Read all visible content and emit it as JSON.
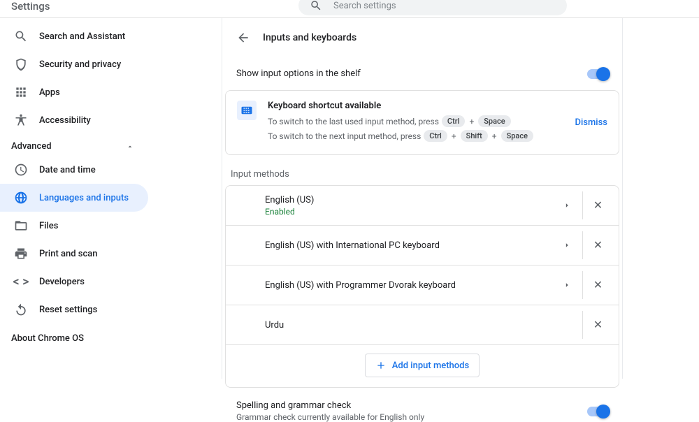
{
  "header": {
    "title": "Settings",
    "search_placeholder": "Search settings"
  },
  "sidebar": {
    "items": [
      {
        "label": "Search and Assistant"
      },
      {
        "label": "Security and privacy"
      },
      {
        "label": "Apps"
      },
      {
        "label": "Accessibility"
      }
    ],
    "advanced_label": "Advanced",
    "advanced_items": [
      {
        "label": "Date and time"
      },
      {
        "label": "Languages and inputs"
      },
      {
        "label": "Files"
      },
      {
        "label": "Print and scan"
      },
      {
        "label": "Developers"
      },
      {
        "label": "Reset settings"
      }
    ],
    "about_label": "About Chrome OS"
  },
  "pane": {
    "title": "Inputs and keyboards",
    "shelf_option_label": "Show input options in the shelf",
    "shelf_option_enabled": true,
    "banner": {
      "title": "Keyboard shortcut available",
      "line1_prefix": "To switch to the last used input method, press",
      "line1_keys": [
        "Ctrl",
        "Space"
      ],
      "line2_prefix": "To switch to the next input method, press",
      "line2_keys": [
        "Ctrl",
        "Shift",
        "Space"
      ],
      "dismiss_label": "Dismiss"
    },
    "input_methods_label": "Input methods",
    "input_methods": [
      {
        "name": "English (US)",
        "status": "Enabled",
        "has_details": true,
        "removable": true
      },
      {
        "name": "English (US) with International PC keyboard",
        "has_details": true,
        "removable": true
      },
      {
        "name": "English (US) with Programmer Dvorak keyboard",
        "has_details": true,
        "removable": true
      },
      {
        "name": "Urdu",
        "has_details": false,
        "removable": true
      }
    ],
    "add_label": "Add input methods",
    "spelling": {
      "title": "Spelling and grammar check",
      "subtitle": "Grammar check currently available for English only",
      "enabled": true
    }
  }
}
